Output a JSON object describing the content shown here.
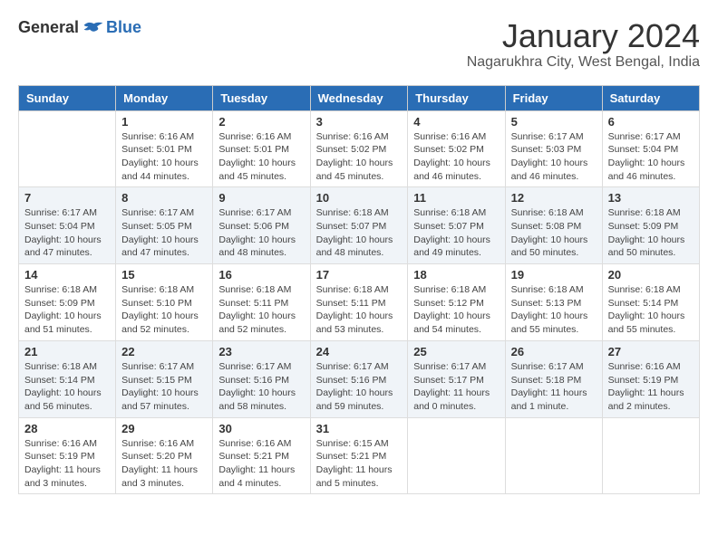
{
  "header": {
    "logo": {
      "general": "General",
      "blue": "Blue"
    },
    "title": "January 2024",
    "location": "Nagarukhra City, West Bengal, India"
  },
  "days_of_week": [
    "Sunday",
    "Monday",
    "Tuesday",
    "Wednesday",
    "Thursday",
    "Friday",
    "Saturday"
  ],
  "weeks": [
    {
      "shaded": false,
      "days": [
        {
          "number": "",
          "sunrise": "",
          "sunset": "",
          "daylight": ""
        },
        {
          "number": "1",
          "sunrise": "Sunrise: 6:16 AM",
          "sunset": "Sunset: 5:01 PM",
          "daylight": "Daylight: 10 hours and 44 minutes."
        },
        {
          "number": "2",
          "sunrise": "Sunrise: 6:16 AM",
          "sunset": "Sunset: 5:01 PM",
          "daylight": "Daylight: 10 hours and 45 minutes."
        },
        {
          "number": "3",
          "sunrise": "Sunrise: 6:16 AM",
          "sunset": "Sunset: 5:02 PM",
          "daylight": "Daylight: 10 hours and 45 minutes."
        },
        {
          "number": "4",
          "sunrise": "Sunrise: 6:16 AM",
          "sunset": "Sunset: 5:02 PM",
          "daylight": "Daylight: 10 hours and 46 minutes."
        },
        {
          "number": "5",
          "sunrise": "Sunrise: 6:17 AM",
          "sunset": "Sunset: 5:03 PM",
          "daylight": "Daylight: 10 hours and 46 minutes."
        },
        {
          "number": "6",
          "sunrise": "Sunrise: 6:17 AM",
          "sunset": "Sunset: 5:04 PM",
          "daylight": "Daylight: 10 hours and 46 minutes."
        }
      ]
    },
    {
      "shaded": true,
      "days": [
        {
          "number": "7",
          "sunrise": "Sunrise: 6:17 AM",
          "sunset": "Sunset: 5:04 PM",
          "daylight": "Daylight: 10 hours and 47 minutes."
        },
        {
          "number": "8",
          "sunrise": "Sunrise: 6:17 AM",
          "sunset": "Sunset: 5:05 PM",
          "daylight": "Daylight: 10 hours and 47 minutes."
        },
        {
          "number": "9",
          "sunrise": "Sunrise: 6:17 AM",
          "sunset": "Sunset: 5:06 PM",
          "daylight": "Daylight: 10 hours and 48 minutes."
        },
        {
          "number": "10",
          "sunrise": "Sunrise: 6:18 AM",
          "sunset": "Sunset: 5:07 PM",
          "daylight": "Daylight: 10 hours and 48 minutes."
        },
        {
          "number": "11",
          "sunrise": "Sunrise: 6:18 AM",
          "sunset": "Sunset: 5:07 PM",
          "daylight": "Daylight: 10 hours and 49 minutes."
        },
        {
          "number": "12",
          "sunrise": "Sunrise: 6:18 AM",
          "sunset": "Sunset: 5:08 PM",
          "daylight": "Daylight: 10 hours and 50 minutes."
        },
        {
          "number": "13",
          "sunrise": "Sunrise: 6:18 AM",
          "sunset": "Sunset: 5:09 PM",
          "daylight": "Daylight: 10 hours and 50 minutes."
        }
      ]
    },
    {
      "shaded": false,
      "days": [
        {
          "number": "14",
          "sunrise": "Sunrise: 6:18 AM",
          "sunset": "Sunset: 5:09 PM",
          "daylight": "Daylight: 10 hours and 51 minutes."
        },
        {
          "number": "15",
          "sunrise": "Sunrise: 6:18 AM",
          "sunset": "Sunset: 5:10 PM",
          "daylight": "Daylight: 10 hours and 52 minutes."
        },
        {
          "number": "16",
          "sunrise": "Sunrise: 6:18 AM",
          "sunset": "Sunset: 5:11 PM",
          "daylight": "Daylight: 10 hours and 52 minutes."
        },
        {
          "number": "17",
          "sunrise": "Sunrise: 6:18 AM",
          "sunset": "Sunset: 5:11 PM",
          "daylight": "Daylight: 10 hours and 53 minutes."
        },
        {
          "number": "18",
          "sunrise": "Sunrise: 6:18 AM",
          "sunset": "Sunset: 5:12 PM",
          "daylight": "Daylight: 10 hours and 54 minutes."
        },
        {
          "number": "19",
          "sunrise": "Sunrise: 6:18 AM",
          "sunset": "Sunset: 5:13 PM",
          "daylight": "Daylight: 10 hours and 55 minutes."
        },
        {
          "number": "20",
          "sunrise": "Sunrise: 6:18 AM",
          "sunset": "Sunset: 5:14 PM",
          "daylight": "Daylight: 10 hours and 55 minutes."
        }
      ]
    },
    {
      "shaded": true,
      "days": [
        {
          "number": "21",
          "sunrise": "Sunrise: 6:18 AM",
          "sunset": "Sunset: 5:14 PM",
          "daylight": "Daylight: 10 hours and 56 minutes."
        },
        {
          "number": "22",
          "sunrise": "Sunrise: 6:17 AM",
          "sunset": "Sunset: 5:15 PM",
          "daylight": "Daylight: 10 hours and 57 minutes."
        },
        {
          "number": "23",
          "sunrise": "Sunrise: 6:17 AM",
          "sunset": "Sunset: 5:16 PM",
          "daylight": "Daylight: 10 hours and 58 minutes."
        },
        {
          "number": "24",
          "sunrise": "Sunrise: 6:17 AM",
          "sunset": "Sunset: 5:16 PM",
          "daylight": "Daylight: 10 hours and 59 minutes."
        },
        {
          "number": "25",
          "sunrise": "Sunrise: 6:17 AM",
          "sunset": "Sunset: 5:17 PM",
          "daylight": "Daylight: 11 hours and 0 minutes."
        },
        {
          "number": "26",
          "sunrise": "Sunrise: 6:17 AM",
          "sunset": "Sunset: 5:18 PM",
          "daylight": "Daylight: 11 hours and 1 minute."
        },
        {
          "number": "27",
          "sunrise": "Sunrise: 6:16 AM",
          "sunset": "Sunset: 5:19 PM",
          "daylight": "Daylight: 11 hours and 2 minutes."
        }
      ]
    },
    {
      "shaded": false,
      "days": [
        {
          "number": "28",
          "sunrise": "Sunrise: 6:16 AM",
          "sunset": "Sunset: 5:19 PM",
          "daylight": "Daylight: 11 hours and 3 minutes."
        },
        {
          "number": "29",
          "sunrise": "Sunrise: 6:16 AM",
          "sunset": "Sunset: 5:20 PM",
          "daylight": "Daylight: 11 hours and 3 minutes."
        },
        {
          "number": "30",
          "sunrise": "Sunrise: 6:16 AM",
          "sunset": "Sunset: 5:21 PM",
          "daylight": "Daylight: 11 hours and 4 minutes."
        },
        {
          "number": "31",
          "sunrise": "Sunrise: 6:15 AM",
          "sunset": "Sunset: 5:21 PM",
          "daylight": "Daylight: 11 hours and 5 minutes."
        },
        {
          "number": "",
          "sunrise": "",
          "sunset": "",
          "daylight": ""
        },
        {
          "number": "",
          "sunrise": "",
          "sunset": "",
          "daylight": ""
        },
        {
          "number": "",
          "sunrise": "",
          "sunset": "",
          "daylight": ""
        }
      ]
    }
  ]
}
